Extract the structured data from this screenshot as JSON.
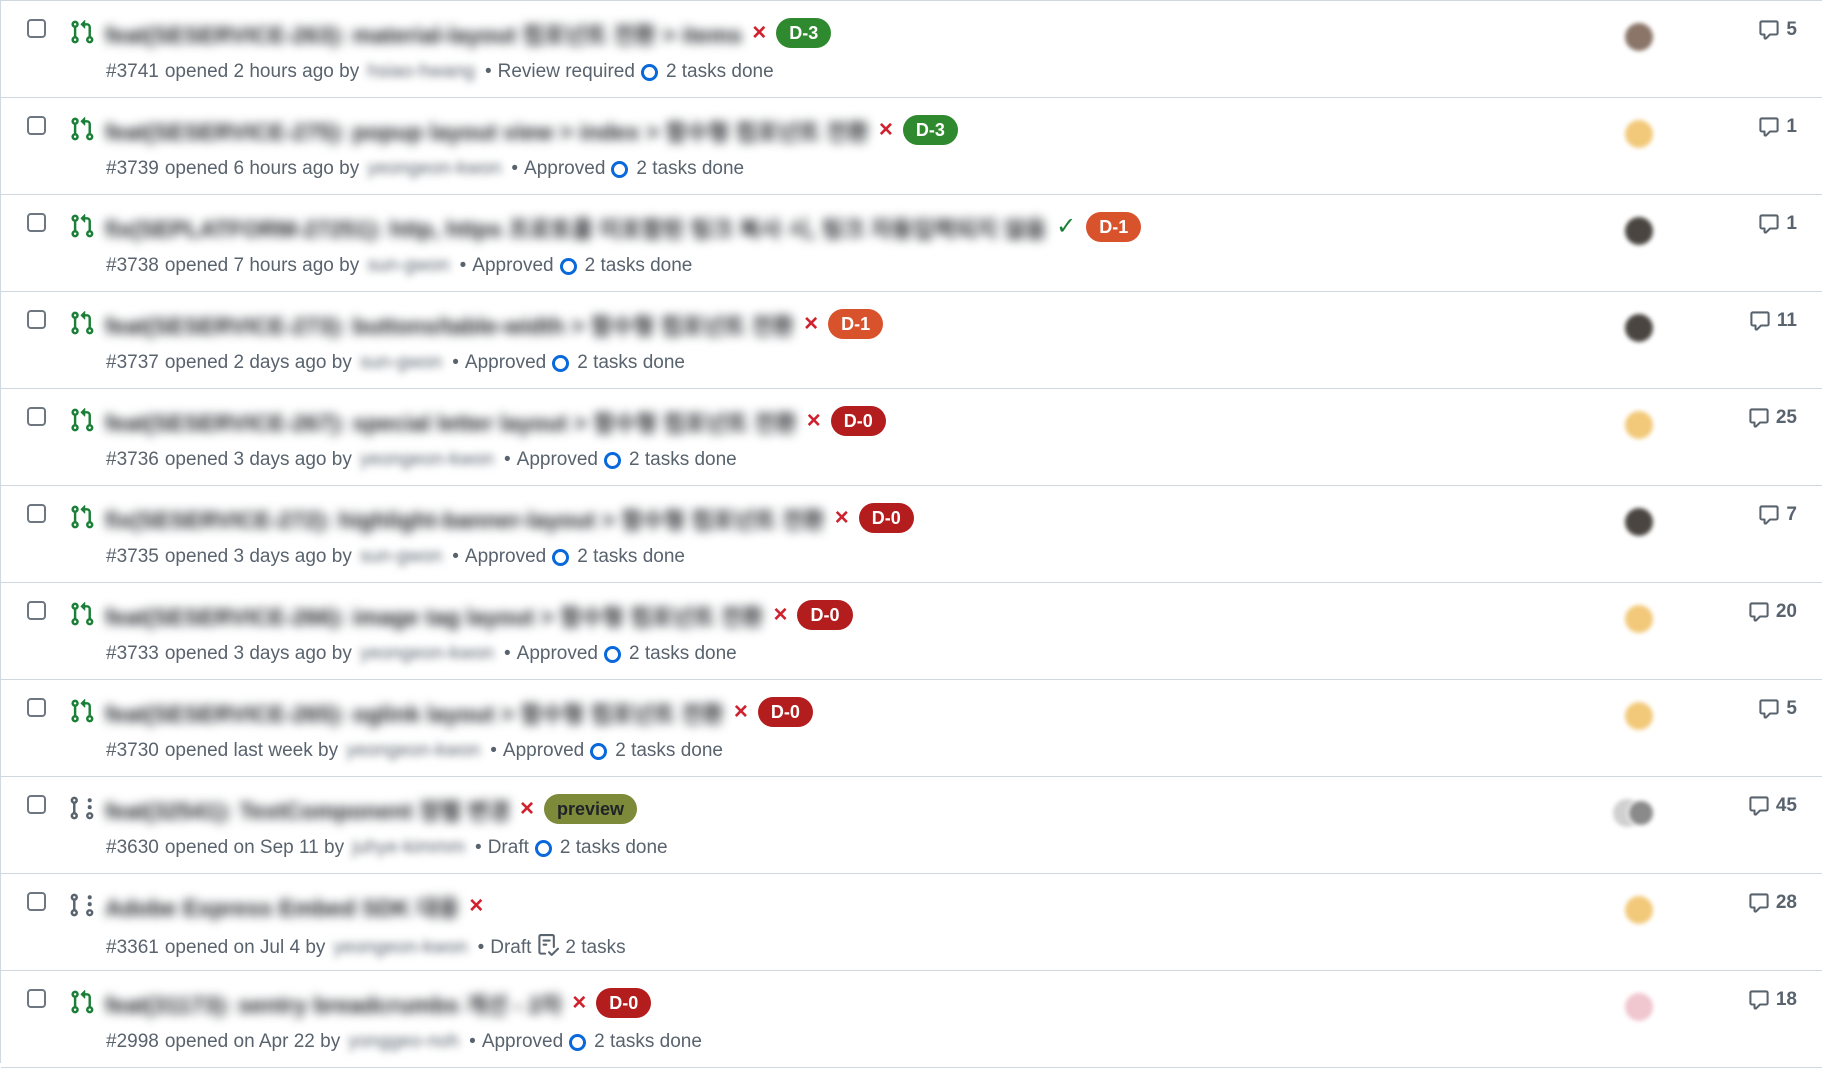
{
  "pull_requests": [
    {
      "number": "#3741",
      "opened": "opened 2 hours ago by",
      "author": "hsiao-hwang",
      "review": "Review required",
      "tasks": "2 tasks done",
      "task_icon": "progress-ring-icon",
      "title": "feat(SESERVICE-263): material-layout 컴포넌트 전환 > items",
      "status": "×",
      "status_type": "fail",
      "label": "D-3",
      "label_color": "#2f8a2f",
      "pr_icon": "git-pull-request-icon",
      "avatar_color": "#8a7568",
      "comments": "5"
    },
    {
      "number": "#3739",
      "opened": "opened 6 hours ago by",
      "author": "yeongeon-kwon",
      "review": "Approved",
      "tasks": "2 tasks done",
      "task_icon": "progress-ring-icon",
      "title": "feat(SESERVICE-275): popup layout view > index > 함수형 컴포넌트 전환",
      "status": "×",
      "status_type": "fail",
      "label": "D-3",
      "label_color": "#2f8a2f",
      "pr_icon": "git-pull-request-icon",
      "avatar_color": "#f2c97a",
      "comments": "1"
    },
    {
      "number": "#3738",
      "opened": "opened 7 hours ago by",
      "author": "sun-gwon",
      "review": "Approved",
      "tasks": "2 tasks done",
      "task_icon": "progress-ring-icon",
      "title": "fix(SEPLATFORM-27251): http, https 프로토콜 미포함된 링크 복사 시, 링크 자동입력되지 않음",
      "status": "✓",
      "status_type": "pass",
      "label": "D-1",
      "label_color": "#d8522b",
      "pr_icon": "git-pull-request-icon",
      "avatar_color": "#4a4540",
      "comments": "1"
    },
    {
      "number": "#3737",
      "opened": "opened 2 days ago by",
      "author": "sun-gwon",
      "review": "Approved",
      "tasks": "2 tasks done",
      "task_icon": "progress-ring-icon",
      "title": "feat(SESERVICE-273): buttons/table-width > 함수형 컴포넌트 전환",
      "status": "×",
      "status_type": "fail",
      "label": "D-1",
      "label_color": "#d8522b",
      "pr_icon": "git-pull-request-icon",
      "avatar_color": "#4a4540",
      "comments": "11"
    },
    {
      "number": "#3736",
      "opened": "opened 3 days ago by",
      "author": "yeongeon-kwon",
      "review": "Approved",
      "tasks": "2 tasks done",
      "task_icon": "progress-ring-icon",
      "title": "feat(SESERVICE-267): special letter layout > 함수형 컴포넌트 전환",
      "status": "×",
      "status_type": "fail",
      "label": "D-0",
      "label_color": "#b31d1d",
      "pr_icon": "git-pull-request-icon",
      "avatar_color": "#f2c97a",
      "comments": "25"
    },
    {
      "number": "#3735",
      "opened": "opened 3 days ago by",
      "author": "sun-gwon",
      "review": "Approved",
      "tasks": "2 tasks done",
      "task_icon": "progress-ring-icon",
      "title": "fix(SESERVICE-272): highlight-banner-layout > 함수형 컴포넌트 전환",
      "status": "×",
      "status_type": "fail",
      "label": "D-0",
      "label_color": "#b31d1d",
      "pr_icon": "git-pull-request-icon",
      "avatar_color": "#4a4540",
      "comments": "7"
    },
    {
      "number": "#3733",
      "opened": "opened 3 days ago by",
      "author": "yeongeon-kwon",
      "review": "Approved",
      "tasks": "2 tasks done",
      "task_icon": "progress-ring-icon",
      "title": "feat(SESERVICE-266): image tag layout > 함수형 컴포넌트 전환",
      "status": "×",
      "status_type": "fail",
      "label": "D-0",
      "label_color": "#b31d1d",
      "pr_icon": "git-pull-request-icon",
      "avatar_color": "#f2c97a",
      "comments": "20"
    },
    {
      "number": "#3730",
      "opened": "opened last week by",
      "author": "yeongeon-kwon",
      "review": "Approved",
      "tasks": "2 tasks done",
      "task_icon": "progress-ring-icon",
      "title": "feat(SESERVICE-265): oglink layout > 함수형 컴포넌트 전환",
      "status": "×",
      "status_type": "fail",
      "label": "D-0",
      "label_color": "#b31d1d",
      "pr_icon": "git-pull-request-icon",
      "avatar_color": "#f2c97a",
      "comments": "5"
    },
    {
      "number": "#3630",
      "opened": "opened on Sep 11 by",
      "author": "juhye-kimmm",
      "review": "Draft",
      "tasks": "2 tasks done",
      "task_icon": "progress-ring-icon",
      "title": "feat(32541): TextComponent 정렬 변경",
      "status": "×",
      "status_type": "fail",
      "label": "preview",
      "label_color": "#7c8a3a",
      "label_text_color": "#1f2328",
      "pr_icon": "git-pull-request-draft-icon",
      "avatar_color": "#d0d0d0",
      "avatar2_color": "#8a8a8a",
      "comments": "45"
    },
    {
      "number": "#3361",
      "opened": "opened on Jul 4 by",
      "author": "yeongeon-kwon",
      "review": "Draft",
      "tasks": "2 tasks",
      "task_icon": "tasklist-icon",
      "title": "Adobe Express Embed SDK 대응",
      "status": "×",
      "status_type": "fail",
      "label": "",
      "label_color": "",
      "pr_icon": "git-pull-request-draft-icon",
      "avatar_color": "#f2c97a",
      "comments": "28"
    },
    {
      "number": "#2998",
      "opened": "opened on Apr 22 by",
      "author": "yonggeo-noh",
      "review": "Approved",
      "tasks": "2 tasks done",
      "task_icon": "progress-ring-icon",
      "title": "feat(31173): sentry breadcrumbs 개선 - 2차",
      "status": "×",
      "status_type": "fail",
      "label": "D-0",
      "label_color": "#b31d1d",
      "pr_icon": "git-pull-request-icon",
      "avatar_color": "#f0c6cf",
      "comments": "18"
    }
  ],
  "meta_separator": "•",
  "colors": {
    "open_icon": "#1a7f37",
    "draft_icon": "#59636e",
    "progress_ring": "#0969da",
    "fail": "#cf222e",
    "pass": "#1a7f37"
  }
}
